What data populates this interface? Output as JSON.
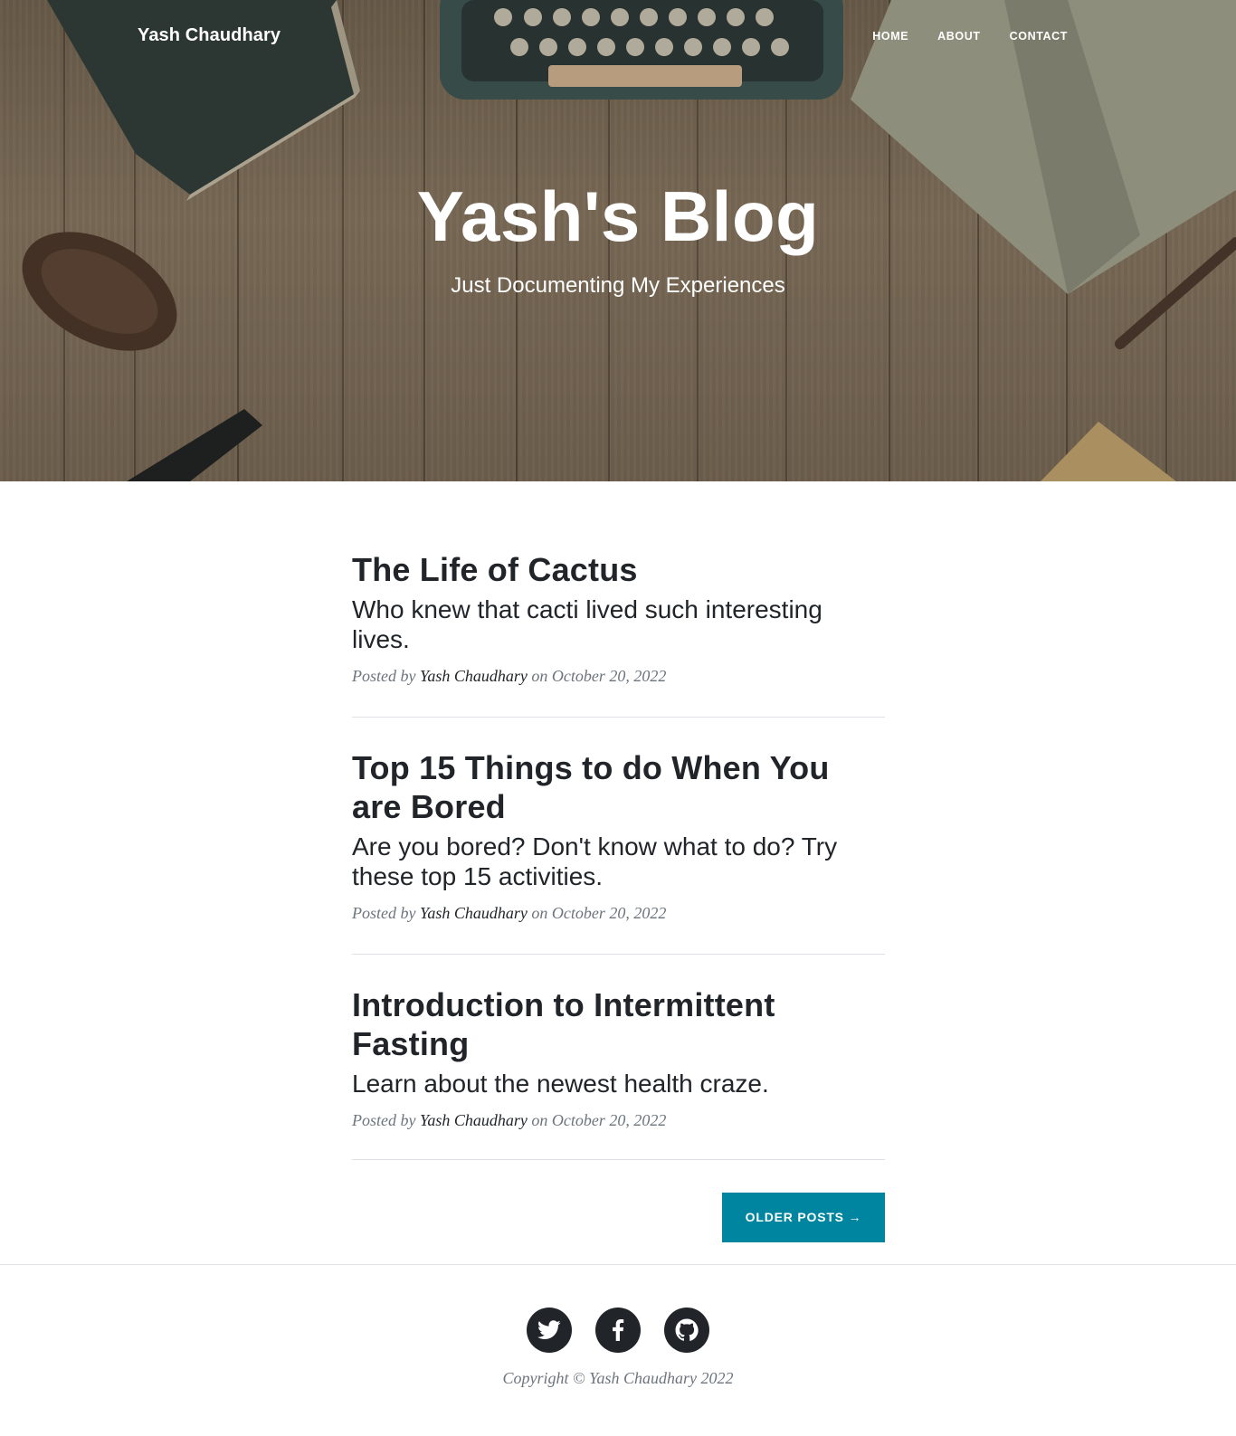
{
  "nav": {
    "brand": "Yash Chaudhary",
    "links": [
      {
        "label": "HOME"
      },
      {
        "label": "ABOUT"
      },
      {
        "label": "CONTACT"
      }
    ]
  },
  "hero": {
    "title": "Yash's Blog",
    "subtitle": "Just Documenting My Experiences"
  },
  "posts": [
    {
      "title": "The Life of Cactus",
      "subtitle": "Who knew that cacti lived such interesting lives.",
      "meta_prefix": "Posted by",
      "author": "Yash Chaudhary",
      "meta_on": "on October 20, 2022"
    },
    {
      "title": "Top 15 Things to do When You are Bored",
      "subtitle": "Are you bored? Don't know what to do? Try these top 15 activities.",
      "meta_prefix": "Posted by",
      "author": "Yash Chaudhary",
      "meta_on": "on October 20, 2022"
    },
    {
      "title": "Introduction to Intermittent Fasting",
      "subtitle": "Learn about the newest health craze.",
      "meta_prefix": "Posted by",
      "author": "Yash Chaudhary",
      "meta_on": "on October 20, 2022"
    }
  ],
  "pager": {
    "older_label": "OLDER POSTS →"
  },
  "footer": {
    "social": [
      {
        "icon": "twitter-icon"
      },
      {
        "icon": "facebook-icon"
      },
      {
        "icon": "github-icon"
      }
    ],
    "copyright": "Copyright © Yash Chaudhary 2022"
  },
  "colors": {
    "accent": "#0085a1",
    "text": "#212529",
    "muted": "#6c757d"
  }
}
